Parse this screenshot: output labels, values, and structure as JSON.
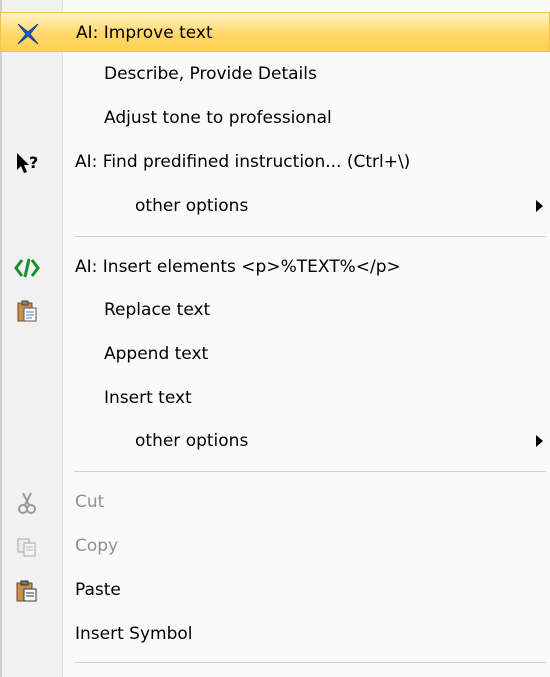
{
  "menu": {
    "item_improve": "AI: Improve text",
    "item_describe": "Describe, Provide Details",
    "item_tone": "Adjust tone to professional",
    "item_find": "AI:  Find predifined instruction... (Ctrl+\\)",
    "item_other1": "other options",
    "item_insert_el": "AI: Insert elements <p>%TEXT%</p>",
    "item_replace": "Replace text",
    "item_append": "Append text",
    "item_insert": "Insert text",
    "item_other2": "other options",
    "item_cut": "Cut",
    "item_copy": "Copy",
    "item_paste": "Paste",
    "item_symbol": "Insert Symbol"
  },
  "icons": {
    "improve": "ai-star-icon",
    "find": "help-pointer-icon",
    "insert_elements": "code-tag-icon",
    "replace": "clipboard-icon",
    "cut": "scissors-icon",
    "copy": "copy-icon",
    "paste": "paste-icon",
    "submenu": "submenu-arrow-icon"
  },
  "colors": {
    "highlight": "#ffd86a",
    "disabled_text": "#8f8f8f",
    "code_icon": "#1a8f2f"
  }
}
